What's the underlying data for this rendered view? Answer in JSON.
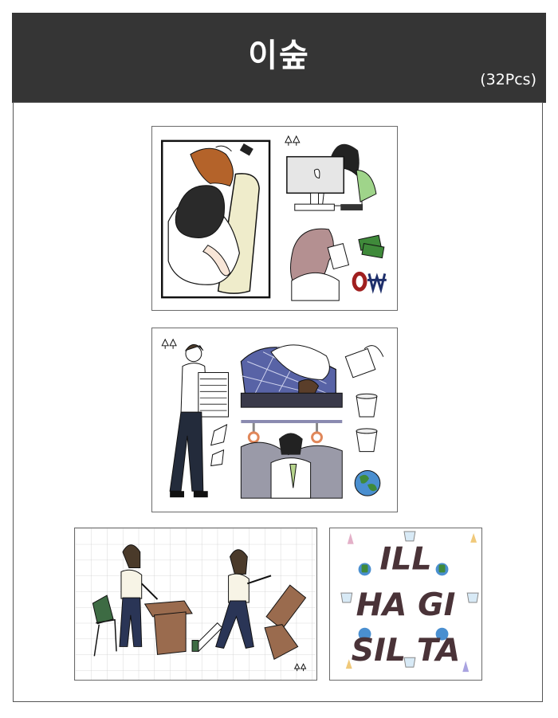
{
  "header": {
    "title": "이숲",
    "count": "(32Pcs)"
  },
  "sheet4": {
    "lines": [
      "ILL",
      "HA GI",
      "SIL TA"
    ]
  },
  "colors": {
    "header_bg": "#353535",
    "hair_orange": "#b4632a",
    "shirt_green": "#9fd48a",
    "money_green": "#3f8a3a",
    "price_red": "#a01f1f",
    "price_navy": "#1e2f6b",
    "blanket_blue": "#5863a6",
    "desk_brown": "#9a6b4e",
    "text_dark": "#4a3338"
  },
  "icons": [
    "tree-icon",
    "cup-icon",
    "globe-icon",
    "like-icon",
    "id-badge-icon",
    "money-icon",
    "phone-icon",
    "candle-icon"
  ]
}
